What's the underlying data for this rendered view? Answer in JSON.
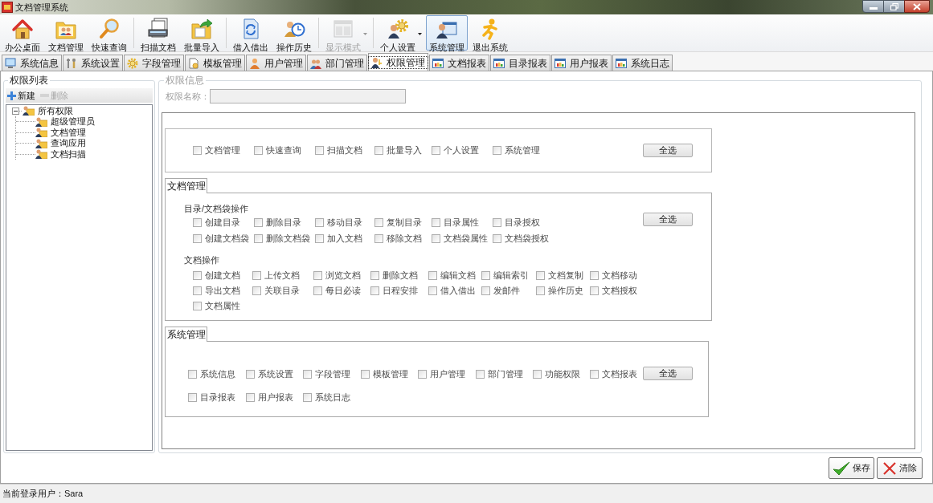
{
  "window": {
    "title": "文档管理系统"
  },
  "toolbar": {
    "groups": [
      [
        {
          "label": "办公桌面",
          "selected": false,
          "disabled": false,
          "dropdown": false
        },
        {
          "label": "文档管理",
          "selected": false,
          "disabled": false,
          "dropdown": false
        },
        {
          "label": "快速查询",
          "selected": false,
          "disabled": false,
          "dropdown": false
        }
      ],
      [
        {
          "label": "扫描文档",
          "selected": false,
          "disabled": false,
          "dropdown": false
        },
        {
          "label": "批量导入",
          "selected": false,
          "disabled": false,
          "dropdown": false
        }
      ],
      [
        {
          "label": "借入借出",
          "selected": false,
          "disabled": false,
          "dropdown": false
        },
        {
          "label": "操作历史",
          "selected": false,
          "disabled": false,
          "dropdown": false
        }
      ],
      [
        {
          "label": "显示模式",
          "selected": false,
          "disabled": true,
          "dropdown": true
        }
      ],
      [
        {
          "label": "个人设置",
          "selected": false,
          "disabled": false,
          "dropdown": true
        },
        {
          "label": "系统管理",
          "selected": true,
          "disabled": false,
          "dropdown": false
        },
        {
          "label": "退出系统",
          "selected": false,
          "disabled": false,
          "dropdown": false
        }
      ]
    ]
  },
  "tabs": [
    {
      "label": "系统信息",
      "selected": false
    },
    {
      "label": "系统设置",
      "selected": false
    },
    {
      "label": "字段管理",
      "selected": false
    },
    {
      "label": "模板管理",
      "selected": false
    },
    {
      "label": "用户管理",
      "selected": false
    },
    {
      "label": "部门管理",
      "selected": false
    },
    {
      "label": "权限管理",
      "selected": true
    },
    {
      "label": "文档报表",
      "selected": false
    },
    {
      "label": "目录报表",
      "selected": false
    },
    {
      "label": "用户报表",
      "selected": false
    },
    {
      "label": "系统日志",
      "selected": false
    }
  ],
  "permission_list": {
    "title": "权限列表",
    "actions": [
      {
        "kind": "add",
        "label": "新建",
        "disabled": false
      },
      {
        "kind": "delete",
        "label": "删除",
        "disabled": true
      }
    ],
    "tree": [
      {
        "label": "所有权限",
        "expanded": true,
        "children": [
          {
            "label": "超级管理员"
          },
          {
            "label": "文档管理"
          },
          {
            "label": "查询应用"
          },
          {
            "label": "文档扫描"
          }
        ]
      }
    ]
  },
  "permission_info": {
    "title": "权限信息",
    "disabled": true,
    "name_label": "权限名称：",
    "modules": {
      "items": [
        {
          "label": "文档管理",
          "checked": false
        },
        {
          "label": "快速查询",
          "checked": false
        },
        {
          "label": "扫描文档",
          "checked": false
        },
        {
          "label": "批量导入",
          "checked": false
        },
        {
          "label": "个人设置",
          "checked": false
        },
        {
          "label": "系统管理",
          "checked": false
        }
      ],
      "select_all": "全选"
    },
    "sections": [
      {
        "tab": "文档管理",
        "groups": [
          {
            "heading": "目录/文档袋操作",
            "items": [
              {
                "label": "创建目录",
                "checked": false
              },
              {
                "label": "删除目录",
                "checked": false
              },
              {
                "label": "移动目录",
                "checked": false
              },
              {
                "label": "复制目录",
                "checked": false
              },
              {
                "label": "目录属性",
                "checked": false
              },
              {
                "label": "目录授权",
                "checked": false
              },
              {
                "label": "创建文档袋",
                "checked": false
              },
              {
                "label": "删除文档袋",
                "checked": false
              },
              {
                "label": "加入文档",
                "checked": false
              },
              {
                "label": "移除文档",
                "checked": false
              },
              {
                "label": "文档袋属性",
                "checked": false
              },
              {
                "label": "文档袋授权",
                "checked": false
              }
            ]
          },
          {
            "heading": "文档操作",
            "items": [
              {
                "label": "创建文档",
                "checked": false
              },
              {
                "label": "上传文档",
                "checked": false
              },
              {
                "label": "浏览文档",
                "checked": false
              },
              {
                "label": "删除文档",
                "checked": false
              },
              {
                "label": "编辑文档",
                "checked": false
              },
              {
                "label": "编辑索引",
                "checked": false
              },
              {
                "label": "文档复制",
                "checked": false
              },
              {
                "label": "文档移动",
                "checked": false
              },
              {
                "label": "导出文档",
                "checked": false
              },
              {
                "label": "关联目录",
                "checked": false
              },
              {
                "label": "每日必读",
                "checked": false
              },
              {
                "label": "日程安排",
                "checked": false
              },
              {
                "label": "借入借出",
                "checked": false
              },
              {
                "label": "发邮件",
                "checked": false
              },
              {
                "label": "操作历史",
                "checked": false
              },
              {
                "label": "文档授权",
                "checked": false
              },
              {
                "label": "文档属性",
                "checked": false
              }
            ]
          }
        ],
        "select_all": "全选"
      },
      {
        "tab": "系统管理",
        "groups": [
          {
            "items": [
              {
                "label": "系统信息",
                "checked": false
              },
              {
                "label": "系统设置",
                "checked": false
              },
              {
                "label": "字段管理",
                "checked": false
              },
              {
                "label": "模板管理",
                "checked": false
              },
              {
                "label": "用户管理",
                "checked": false
              },
              {
                "label": "部门管理",
                "checked": false
              },
              {
                "label": "功能权限",
                "checked": false
              },
              {
                "label": "文档报表",
                "checked": false
              },
              {
                "label": "目录报表",
                "checked": false
              },
              {
                "label": "用户报表",
                "checked": false
              },
              {
                "label": "系统日志",
                "checked": false
              }
            ]
          }
        ],
        "select_all": "全选"
      }
    ]
  },
  "actions": [
    {
      "kind": "save",
      "label": "保存"
    },
    {
      "kind": "clear",
      "label": "清除"
    }
  ],
  "status_bar": {
    "text": "当前登录用户：Sara"
  }
}
